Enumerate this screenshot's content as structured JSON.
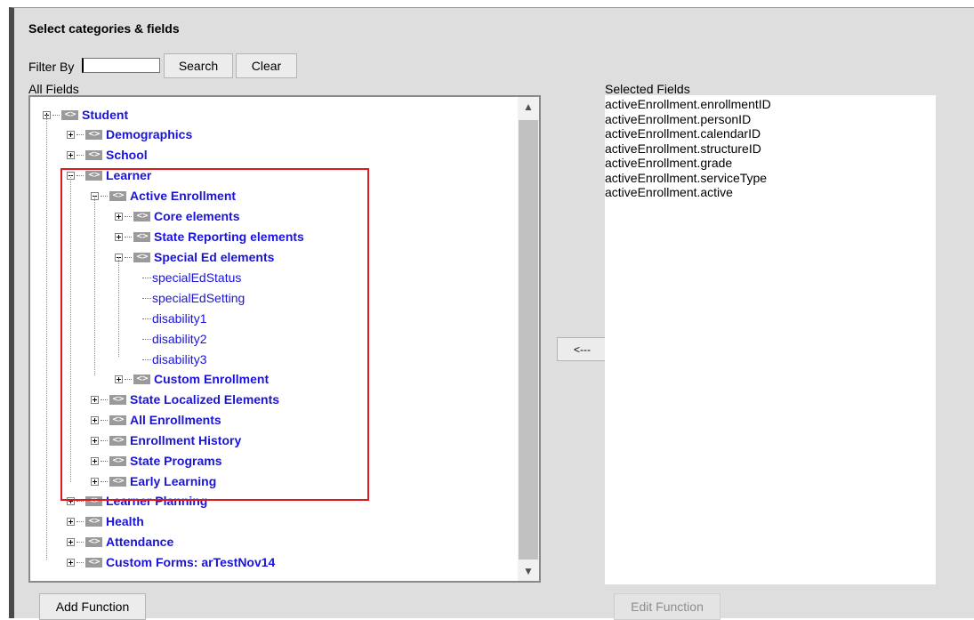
{
  "header": {
    "title": "Select categories & fields"
  },
  "filter": {
    "label": "Filter By",
    "value": "",
    "search_label": "Search",
    "clear_label": "Clear"
  },
  "all_fields": {
    "label": "All Fields",
    "tree": [
      {
        "label": "Student",
        "kind": "category",
        "state": "expanded-plus"
      },
      {
        "label": "Demographics",
        "kind": "category",
        "state": "collapsed"
      },
      {
        "label": "School",
        "kind": "category",
        "state": "collapsed"
      },
      {
        "label": "Learner",
        "kind": "category",
        "state": "expanded"
      },
      {
        "label": "Active Enrollment",
        "kind": "category",
        "state": "expanded"
      },
      {
        "label": "Core elements",
        "kind": "category",
        "state": "collapsed"
      },
      {
        "label": "State Reporting elements",
        "kind": "category",
        "state": "collapsed"
      },
      {
        "label": "Special Ed elements",
        "kind": "category",
        "state": "expanded"
      },
      {
        "label": "specialEdStatus",
        "kind": "field"
      },
      {
        "label": "specialEdSetting",
        "kind": "field"
      },
      {
        "label": "disability1",
        "kind": "field"
      },
      {
        "label": "disability2",
        "kind": "field"
      },
      {
        "label": "disability3",
        "kind": "field"
      },
      {
        "label": "Custom Enrollment",
        "kind": "category",
        "state": "collapsed"
      },
      {
        "label": "State Localized Elements",
        "kind": "category",
        "state": "collapsed"
      },
      {
        "label": "All Enrollments",
        "kind": "category",
        "state": "collapsed"
      },
      {
        "label": "Enrollment History",
        "kind": "category",
        "state": "collapsed"
      },
      {
        "label": "State Programs",
        "kind": "category",
        "state": "collapsed"
      },
      {
        "label": "Early Learning",
        "kind": "category",
        "state": "collapsed"
      },
      {
        "label": "Learner Planning",
        "kind": "category",
        "state": "collapsed"
      },
      {
        "label": "Health",
        "kind": "category",
        "state": "collapsed"
      },
      {
        "label": "Attendance",
        "kind": "category",
        "state": "collapsed"
      },
      {
        "label": "Custom Forms: arTestNov14",
        "kind": "category",
        "state": "collapsed"
      }
    ]
  },
  "move_button": {
    "label": "<---"
  },
  "selected_fields": {
    "label": "Selected Fields",
    "items": [
      "activeEnrollment.enrollmentID",
      "activeEnrollment.personID",
      "activeEnrollment.calendarID",
      "activeEnrollment.structureID",
      "activeEnrollment.grade",
      "activeEnrollment.serviceType",
      "activeEnrollment.active"
    ]
  },
  "footer": {
    "add_function_label": "Add Function",
    "edit_function_label": "Edit Function"
  },
  "icons": {
    "category_icon_text": "<>",
    "scroll_up": "^",
    "scroll_down": "v"
  },
  "colors": {
    "link_blue": "#1a14d8",
    "highlight_red": "#e0191e",
    "panel_bg": "#dedede"
  }
}
